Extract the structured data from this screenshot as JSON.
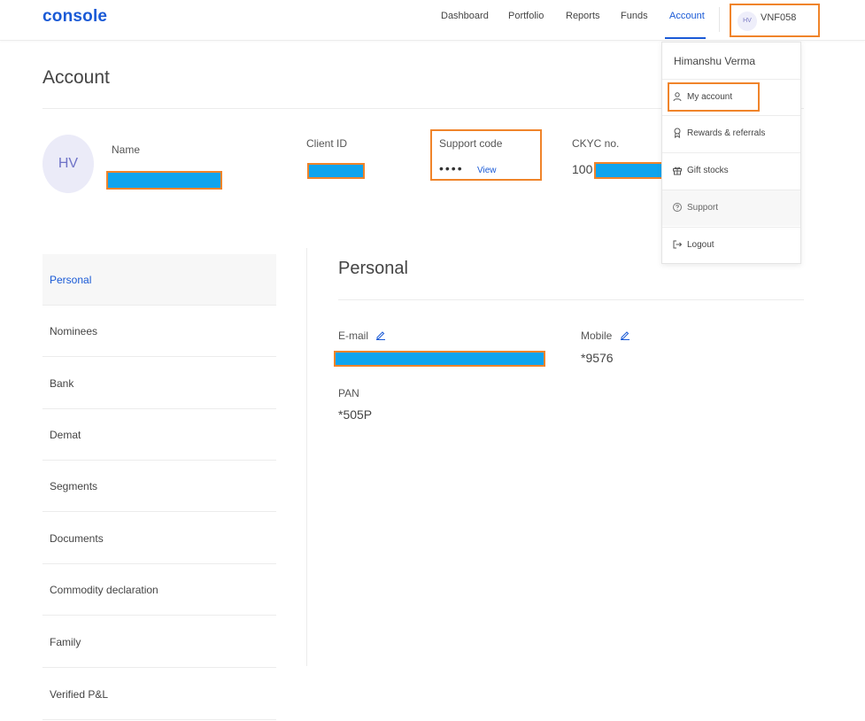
{
  "brand": "console",
  "nav": {
    "links": [
      "Dashboard",
      "Portfolio",
      "Reports",
      "Funds",
      "Account"
    ],
    "active": "Account",
    "user_initials": "HV",
    "user_id": "VNF058"
  },
  "page": {
    "title": "Account"
  },
  "profile": {
    "initials": "HV",
    "name_label": "Name",
    "client_id_label": "Client ID",
    "support_code_label": "Support code",
    "support_code_masked": "••••",
    "support_code_view": "View",
    "ckyc_label": "CKYC no.",
    "ckyc_value_prefix": "100"
  },
  "sidebar": {
    "items": [
      "Personal",
      "Nominees",
      "Bank",
      "Demat",
      "Segments",
      "Documents",
      "Commodity declaration",
      "Family",
      "Verified P&L"
    ],
    "active": "Personal"
  },
  "personal": {
    "title": "Personal",
    "email_label": "E-mail",
    "mobile_label": "Mobile",
    "mobile_value": "*9576",
    "pan_label": "PAN",
    "pan_value": "*505P"
  },
  "dropdown": {
    "user_name": "Himanshu Verma",
    "items": [
      {
        "label": "My account",
        "icon": "user-icon"
      },
      {
        "label": "Rewards & referrals",
        "icon": "medal-icon"
      },
      {
        "label": "Gift stocks",
        "icon": "gift-icon"
      },
      {
        "label": "Support",
        "icon": "help-icon"
      },
      {
        "label": "Logout",
        "icon": "logout-icon"
      }
    ]
  },
  "colors": {
    "accent": "#1a5ad6",
    "highlight_border": "#f0842a",
    "redaction": "#0fa4ee"
  }
}
